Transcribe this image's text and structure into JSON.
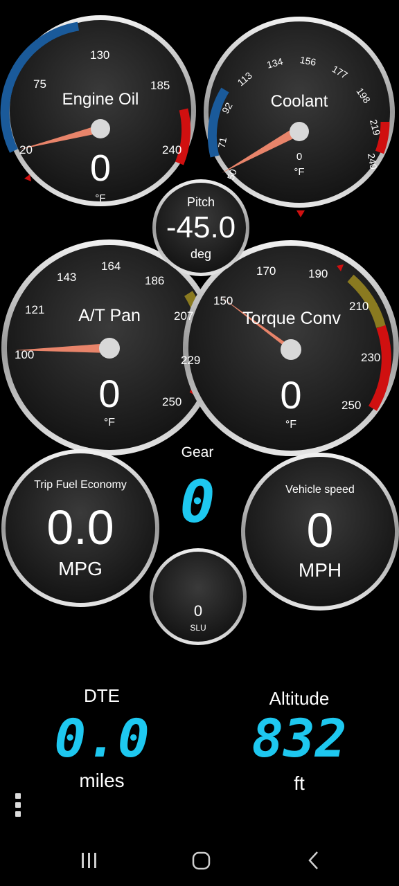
{
  "gauges": {
    "engine_oil": {
      "title": "Engine Oil",
      "value": "0",
      "unit": "°F",
      "ticks": [
        "20",
        "75",
        "130",
        "185",
        "240"
      ]
    },
    "coolant": {
      "title": "Coolant",
      "value": "0",
      "unit": "°F",
      "ticks": [
        "50",
        "71",
        "92",
        "113",
        "134",
        "156",
        "177",
        "198",
        "219",
        "240"
      ]
    },
    "pitch": {
      "title": "Pitch",
      "value": "-45.0",
      "unit": "deg"
    },
    "at_pan": {
      "title": "A/T Pan",
      "value": "0",
      "unit": "°F",
      "ticks": [
        "100",
        "121",
        "143",
        "164",
        "186",
        "207",
        "229",
        "250"
      ]
    },
    "torque_conv": {
      "title": "Torque Conv",
      "value": "0",
      "unit": "°F",
      "ticks": [
        "150",
        "170",
        "190",
        "210",
        "230",
        "250"
      ]
    },
    "trip_fuel": {
      "title": "Trip Fuel Economy",
      "value": "0.0",
      "unit": "MPG"
    },
    "vehicle_speed": {
      "title": "Vehicle speed",
      "value": "0",
      "unit": "MPH"
    },
    "slu": {
      "value": "0",
      "unit": "SLU"
    }
  },
  "gear": {
    "label": "Gear",
    "value": "0"
  },
  "dte": {
    "label": "DTE",
    "value": "0.0",
    "unit": "miles"
  },
  "altitude": {
    "label": "Altitude",
    "value": "832",
    "unit": "ft"
  },
  "colors": {
    "lcd": "#1ec8f0",
    "needle": "#e8846a",
    "cold_band": "#1a5a9a",
    "hot_band": "#d01010",
    "warn_band": "#8a7a20"
  },
  "icons": [
    "overflow-menu-icon",
    "nav-recents-icon",
    "nav-home-icon",
    "nav-back-icon"
  ]
}
